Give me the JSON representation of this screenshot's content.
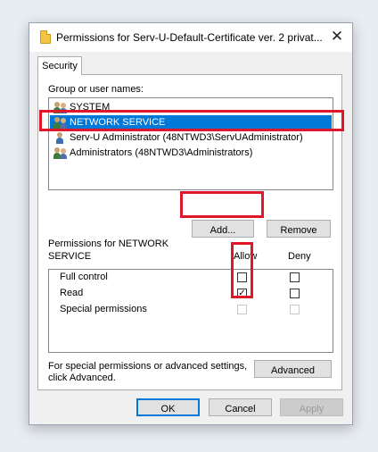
{
  "dialog": {
    "title": "Permissions for Serv-U-Default-Certificate ver. 2 privat...",
    "close_glyph": "✕"
  },
  "tabs": [
    {
      "label": "Security",
      "selected": true
    }
  ],
  "group_label": "Group or user names:",
  "users": [
    {
      "name": "SYSTEM",
      "icon": "user-group-icon",
      "selected": false
    },
    {
      "name": "NETWORK SERVICE",
      "icon": "user-group-icon",
      "selected": true
    },
    {
      "name": "Serv-U Administrator (48NTWD3\\ServUAdministrator)",
      "icon": "user-icon",
      "selected": false
    },
    {
      "name": "Administrators (48NTWD3\\Administrators)",
      "icon": "user-group-icon",
      "selected": false
    }
  ],
  "buttons": {
    "add": "Add...",
    "remove": "Remove",
    "advanced": "Advanced",
    "ok": "OK",
    "cancel": "Cancel",
    "apply": "Apply"
  },
  "permissions": {
    "header_line1": "Permissions for NETWORK",
    "header_line2": "SERVICE",
    "allow_label": "Allow",
    "deny_label": "Deny",
    "rows": [
      {
        "name": "Full control",
        "allow": false,
        "deny": false,
        "disabled": false
      },
      {
        "name": "Read",
        "allow": true,
        "deny": false,
        "disabled": false
      },
      {
        "name": "Special permissions",
        "allow": false,
        "deny": false,
        "disabled": true
      }
    ]
  },
  "advanced_text_line1": "For special permissions or advanced settings,",
  "advanced_text_line2": "click Advanced.",
  "checkmark_glyph": "✓",
  "highlight_color": "#e0162b",
  "selection_color": "#0078d7"
}
